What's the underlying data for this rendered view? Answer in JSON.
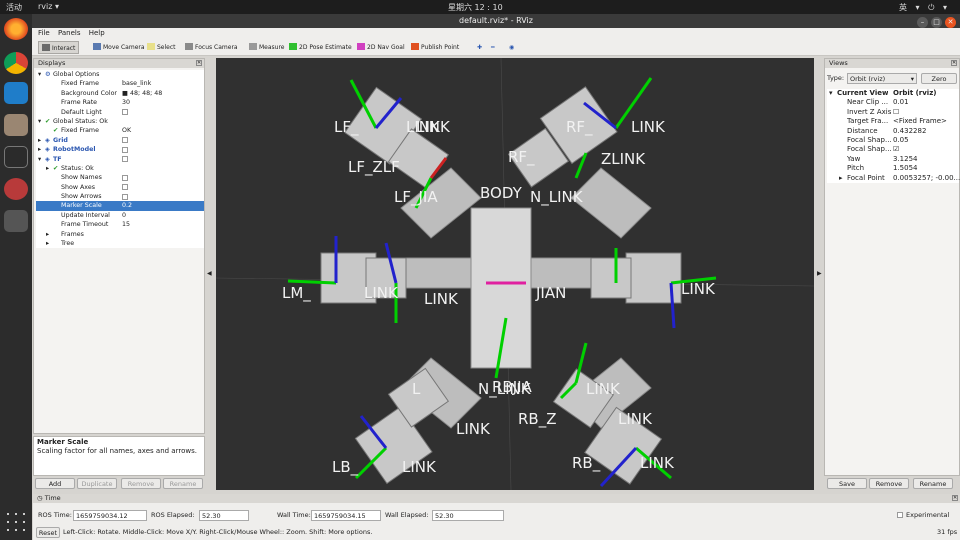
{
  "system": {
    "activities": "活动",
    "app_name": "rviz",
    "clock": "星期六 12 : 10",
    "tray": "英 ▾  ⏻ ▾"
  },
  "window": {
    "title": "default.rviz* - RViz",
    "minimize": "–",
    "maximize": "□",
    "close": "✕"
  },
  "menu": [
    "File",
    "Panels",
    "Help"
  ],
  "toolbar": [
    {
      "label": "Interact",
      "icon": "interact-icon",
      "color": "#6a6a6a",
      "active": true
    },
    {
      "label": "Move Camera",
      "icon": "move-camera-icon",
      "color": "#5a7ab0"
    },
    {
      "label": "Select",
      "icon": "select-icon",
      "color": "#e8e08a"
    },
    {
      "label": "Focus Camera",
      "icon": "focus-camera-icon",
      "color": "#8a8a8a"
    },
    {
      "label": "Measure",
      "icon": "measure-icon",
      "color": "#999999"
    },
    {
      "label": "2D Pose Estimate",
      "icon": "pose-estimate-icon",
      "color": "#30c030"
    },
    {
      "label": "2D Nav Goal",
      "icon": "nav-goal-icon",
      "color": "#d040c0"
    },
    {
      "label": "Publish Point",
      "icon": "publish-point-icon",
      "color": "#e05020"
    }
  ],
  "toolbar_extra": [
    "✚",
    "━",
    "◉"
  ],
  "displays": {
    "title": "Displays",
    "rows": [
      {
        "indent": 0,
        "arrow": "▾",
        "icon": "gear-icon",
        "key": "Global Options",
        "value": "",
        "cls": ""
      },
      {
        "indent": 1,
        "arrow": "",
        "icon": "",
        "key": "Fixed Frame",
        "value": "base_link",
        "cls": ""
      },
      {
        "indent": 1,
        "arrow": "",
        "icon": "",
        "key": "Background Color",
        "value": "■ 48; 48; 48",
        "cls": ""
      },
      {
        "indent": 1,
        "arrow": "",
        "icon": "",
        "key": "Frame Rate",
        "value": "30",
        "cls": ""
      },
      {
        "indent": 1,
        "arrow": "",
        "icon": "",
        "key": "Default Light",
        "value": "☑",
        "cls": ""
      },
      {
        "indent": 0,
        "arrow": "▾",
        "icon": "check-icon",
        "key": "Global Status: Ok",
        "value": "",
        "cls": ""
      },
      {
        "indent": 1,
        "arrow": "",
        "icon": "check-icon",
        "key": "Fixed Frame",
        "value": "OK",
        "cls": ""
      },
      {
        "indent": 0,
        "arrow": "▸",
        "icon": "grid-icon",
        "key": "Grid",
        "value": "☑",
        "cls": "blue"
      },
      {
        "indent": 0,
        "arrow": "▸",
        "icon": "robot-icon",
        "key": "RobotModel",
        "value": "☑",
        "cls": "blue"
      },
      {
        "indent": 0,
        "arrow": "▾",
        "icon": "tf-icon",
        "key": "TF",
        "value": "☑",
        "cls": "blue"
      },
      {
        "indent": 1,
        "arrow": "▸",
        "icon": "check-icon",
        "key": "Status: Ok",
        "value": "",
        "cls": ""
      },
      {
        "indent": 1,
        "arrow": "",
        "icon": "",
        "key": "Show Names",
        "value": "☑",
        "cls": ""
      },
      {
        "indent": 1,
        "arrow": "",
        "icon": "",
        "key": "Show Axes",
        "value": "☑",
        "cls": ""
      },
      {
        "indent": 1,
        "arrow": "",
        "icon": "",
        "key": "Show Arrows",
        "value": "☑",
        "cls": ""
      },
      {
        "indent": 1,
        "arrow": "",
        "icon": "",
        "key": "Marker Scale",
        "value": "0.2",
        "cls": "",
        "selected": true
      },
      {
        "indent": 1,
        "arrow": "",
        "icon": "",
        "key": "Update Interval",
        "value": "0",
        "cls": ""
      },
      {
        "indent": 1,
        "arrow": "",
        "icon": "",
        "key": "Frame Timeout",
        "value": "15",
        "cls": ""
      },
      {
        "indent": 1,
        "arrow": "▸",
        "icon": "",
        "key": "Frames",
        "value": "",
        "cls": ""
      },
      {
        "indent": 1,
        "arrow": "▸",
        "icon": "",
        "key": "Tree",
        "value": "",
        "cls": ""
      }
    ],
    "help_title": "Marker Scale",
    "help_text": "Scaling factor for all names, axes and arrows.",
    "buttons": [
      {
        "label": "Add",
        "disabled": false
      },
      {
        "label": "Duplicate",
        "disabled": true
      },
      {
        "label": "Remove",
        "disabled": true
      },
      {
        "label": "Rename",
        "disabled": true
      }
    ]
  },
  "views": {
    "title": "Views",
    "type_label": "Type:",
    "type_value": "Orbit (rviz)",
    "zero": "Zero",
    "header_key": "Current View",
    "header_value": "Orbit (rviz)",
    "rows": [
      {
        "key": "Near Clip ...",
        "value": "0.01",
        "arrow": ""
      },
      {
        "key": "Invert Z Axis",
        "value": "☐",
        "arrow": ""
      },
      {
        "key": "Target Fra...",
        "value": "<Fixed Frame>",
        "arrow": ""
      },
      {
        "key": "Distance",
        "value": "0.432282",
        "arrow": ""
      },
      {
        "key": "Focal Shap...",
        "value": "0.05",
        "arrow": ""
      },
      {
        "key": "Focal Shap...",
        "value": "☑",
        "arrow": ""
      },
      {
        "key": "Yaw",
        "value": "3.1254",
        "arrow": ""
      },
      {
        "key": "Pitch",
        "value": "1.5054",
        "arrow": ""
      },
      {
        "key": "Focal Point",
        "value": "0.0053257; -0.00...",
        "arrow": "▸"
      }
    ],
    "buttons": [
      "Save",
      "Remove",
      "Rename"
    ]
  },
  "scene_labels": [
    "LF_",
    "LINK",
    "LF_ZLF",
    "LINK",
    "LF_JIA",
    "BODY",
    "N_LINK",
    "RF_",
    "LINK",
    "RF_",
    "ZLINK",
    "LM_",
    "LINK",
    "LINK",
    "JIAN",
    "LINK",
    "L",
    "N_LINK",
    "RBJIA",
    "LINK",
    "RB_Z",
    "LINK",
    "LINK",
    "LB_",
    "LINK",
    "RB_",
    "LINK"
  ],
  "time": {
    "title": "Time",
    "ros_time_label": "ROS Time:",
    "ros_time": "1659759034.12",
    "ros_elapsed_label": "ROS Elapsed:",
    "ros_elapsed": "52.30",
    "wall_time_label": "Wall Time:",
    "wall_time": "1659759034.15",
    "wall_elapsed_label": "Wall Elapsed:",
    "wall_elapsed": "52.30",
    "experimental": "Experimental",
    "reset": "Reset",
    "help": "Left-Click: Rotate. Middle-Click: Move X/Y. Right-Click/Mouse Wheel:: Zoom. Shift: More options.",
    "fps": "31 fps"
  },
  "colors": {
    "accent": "#3a7ac6",
    "bg3d": "#303030",
    "ubuntu_orange": "#e95420"
  }
}
